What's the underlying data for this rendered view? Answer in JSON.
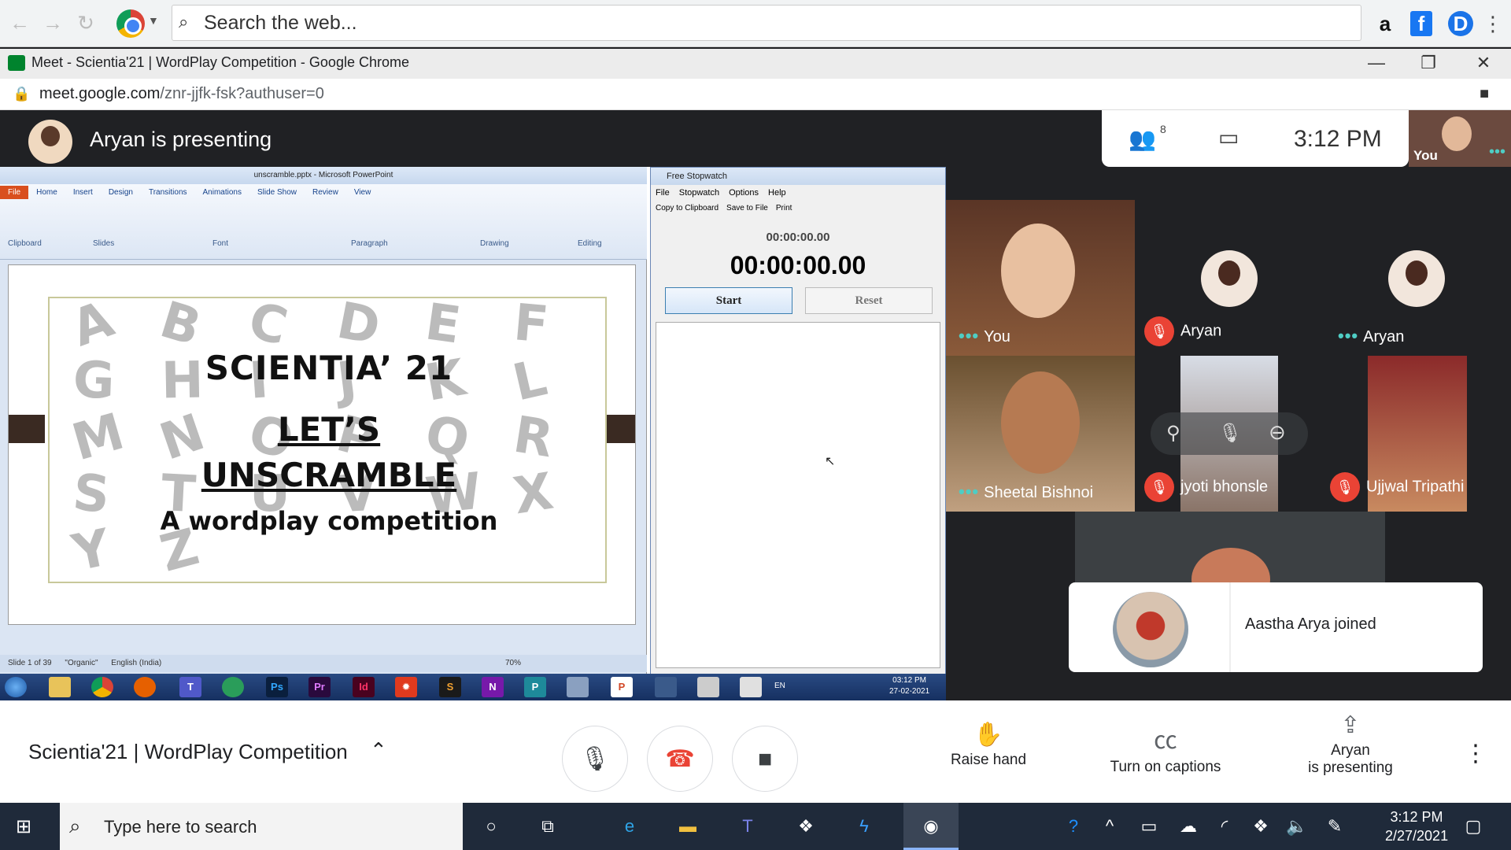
{
  "browser": {
    "search_placeholder": "Search the web...",
    "window_title": "Meet - Scientia'21 | WordPlay Competition - Google Chrome",
    "url_host": "meet.google.com",
    "url_path": "/znr-jjfk-fsk?authuser=0",
    "toolbar_icons": [
      "amazon-icon",
      "facebook-icon",
      "profile-icon",
      "menu-icon"
    ]
  },
  "meet": {
    "presenting_label": "Aryan is presenting",
    "participant_count": "8",
    "time": "3:12  PM",
    "self_label": "You",
    "toast": "Aastha Arya joined",
    "meeting_name": "Scientia'21 | WordPlay Competition",
    "actions": {
      "raise_hand": "Raise hand",
      "captions": "Turn on captions",
      "present_line1": "Aryan",
      "present_line2": "is presenting"
    },
    "tiles": [
      {
        "name": "You",
        "status": "speaking"
      },
      {
        "name": "Aryan",
        "status": "muted"
      },
      {
        "name": "Aryan",
        "status": "speaking"
      },
      {
        "name": "Sheetal Bishnoi",
        "status": "speaking"
      },
      {
        "name": "jyoti bhonsle",
        "status": "muted"
      },
      {
        "name": "Ujjwal Tripathi",
        "status": "muted"
      }
    ]
  },
  "ppt": {
    "title": "unscramble.pptx - Microsoft PowerPoint",
    "tabs": [
      "File",
      "Home",
      "Insert",
      "Design",
      "Transitions",
      "Animations",
      "Slide Show",
      "Review",
      "View"
    ],
    "groups": [
      "Clipboard",
      "Slides",
      "Font",
      "Paragraph",
      "Drawing",
      "Editing"
    ],
    "slide": {
      "line1": "SCIENTIA’ 21",
      "line2": "LET’S",
      "line3": "UNSCRAMBLE",
      "line4": "A wordplay competition",
      "letters": [
        "A",
        "B",
        "C",
        "D",
        "E",
        "F",
        "G",
        "H",
        "I",
        "J",
        "K",
        "L",
        "M",
        "N",
        "O",
        "P",
        "Q",
        "R",
        "S",
        "T",
        "U",
        "V",
        "W",
        "X",
        "Y",
        "Z"
      ]
    },
    "status": [
      "Slide 1 of 39",
      "\"Organic\"",
      "English (India)",
      "70%"
    ]
  },
  "stopwatch": {
    "title": "Free Stopwatch",
    "menu": [
      "File",
      "Stopwatch",
      "Options",
      "Help"
    ],
    "toolbar": [
      "Copy to Clipboard",
      "Save to File",
      "Print"
    ],
    "small_time": "00:00:00.00",
    "big_time": "00:00:00.00",
    "start": "Start",
    "reset": "Reset"
  },
  "win7_taskbar": {
    "lang": "EN",
    "time": "03:12 PM",
    "date": "27-02-2021"
  },
  "win10_taskbar": {
    "search": "Type here to search",
    "time": "3:12 PM",
    "date": "2/27/2021"
  }
}
